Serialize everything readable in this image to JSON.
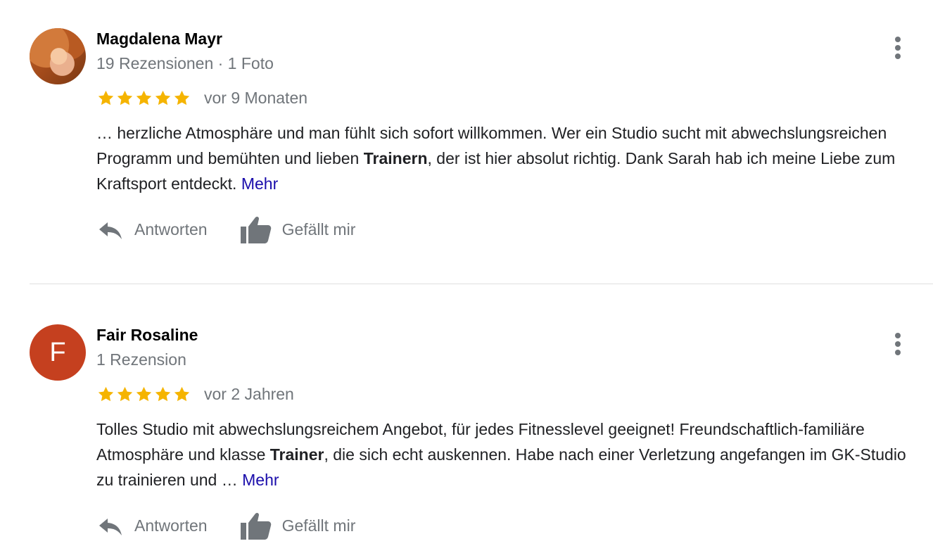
{
  "reviews": [
    {
      "author": "Magdalena Mayr",
      "meta": "19 Rezensionen · 1 Foto",
      "rating": 5,
      "date": "vor 9 Monaten",
      "text_before": "… herzliche Atmosphäre und man fühlt sich sofort willkommen. Wer ein Studio sucht mit abwechslungsreichen Programm und bemühten und lieben ",
      "text_bold": "Trainern",
      "text_after": ", der ist hier absolut richtig. Dank Sarah hab ich meine Liebe zum Kraftsport entdeckt. ",
      "more": "Mehr",
      "reply": "Antworten",
      "like": "Gefällt mir"
    },
    {
      "author": "Fair Rosaline",
      "avatar_letter": "F",
      "meta": "1 Rezension",
      "rating": 5,
      "date": "vor 2 Jahren",
      "text_before": "Tolles Studio mit abwechslungsreichem Angebot, für jedes Fitnesslevel geeignet! Freundschaftlich-familiäre Atmosphäre und klasse ",
      "text_bold": "Trainer",
      "text_after": ", die sich echt auskennen. Habe nach einer Verletzung angefangen im GK-Studio zu trainieren und … ",
      "more": "Mehr",
      "reply": "Antworten",
      "like": "Gefällt mir"
    }
  ],
  "colors": {
    "star": "#f5b400",
    "link": "#1a0dab",
    "secondary_text": "#70757a",
    "avatar_f": "#c5401f"
  },
  "icons": {
    "reply": "reply-icon",
    "like": "thumbs-up-icon",
    "menu": "more-vert-icon",
    "star": "star-icon"
  }
}
